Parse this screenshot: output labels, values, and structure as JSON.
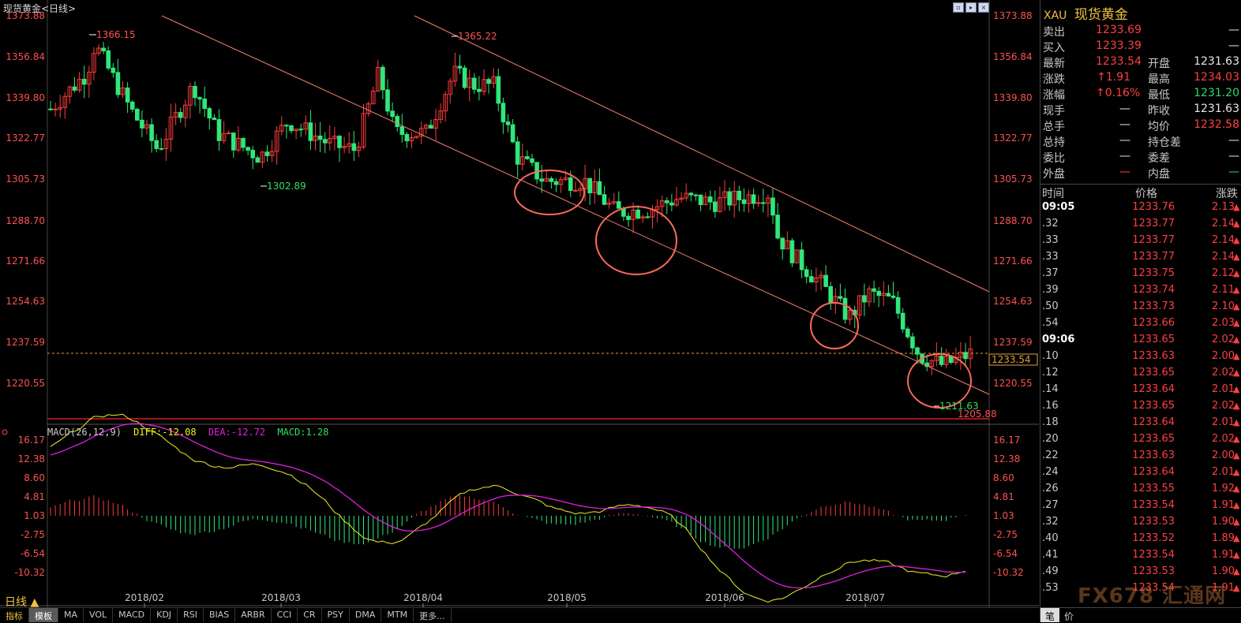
{
  "window": {
    "title": "现货黄金<日线>"
  },
  "chart": {
    "price_axis": [
      "1373.88",
      "1356.84",
      "1339.80",
      "1322.77",
      "1305.73",
      "1288.70",
      "1271.66",
      "1254.63",
      "1237.59",
      "1220.55"
    ],
    "macd_axis": [
      "16.17",
      "12.38",
      "8.60",
      "4.81",
      "1.03",
      "-2.75",
      "-6.54",
      "-10.32"
    ],
    "x_labels": [
      "2018/02",
      "2018/03",
      "2018/04",
      "2018/05",
      "2018/06",
      "2018/07"
    ],
    "annotations": {
      "high1": "1366.15",
      "high2": "1365.22",
      "low1": "1302.89",
      "low2": "1211.63",
      "bottom_price": "1205.88",
      "current_price": "1233.54"
    },
    "macd_legend": {
      "name": "MACD(26,12,9)",
      "diff": "DIFF:-12.08",
      "dea": "DEA:-12.72",
      "macd": "MACD:1.28"
    },
    "period_label": "日线 ▲",
    "colors": {
      "up": "#ff3b3b",
      "down": "#2ee87a",
      "diff": "#f0f020",
      "dea": "#e020e0",
      "trend": "#f08070"
    }
  },
  "indicator_tabs": [
    "指标",
    "模板",
    "MA",
    "VOL",
    "MACD",
    "KDJ",
    "RSI",
    "BIAS",
    "ARBR",
    "CCI",
    "CR",
    "PSY",
    "DMA",
    "MTM",
    "更多..."
  ],
  "quote": {
    "code": "XAU",
    "name": "现货黄金",
    "rows": [
      {
        "l1": "卖出",
        "v1": "1233.69",
        "c1": "red",
        "l2": "",
        "v2": "—",
        "c2": "white"
      },
      {
        "l1": "买入",
        "v1": "1233.39",
        "c1": "red",
        "l2": "",
        "v2": "—",
        "c2": "white"
      },
      {
        "l1": "最新",
        "v1": "1233.54",
        "c1": "red",
        "l2": "开盘",
        "v2": "1231.63",
        "c2": "white"
      },
      {
        "l1": "涨跌",
        "v1": "↑1.91",
        "c1": "red",
        "l2": "最高",
        "v2": "1234.03",
        "c2": "red"
      },
      {
        "l1": "涨幅",
        "v1": "↑0.16%",
        "c1": "red",
        "l2": "最低",
        "v2": "1231.20",
        "c2": "green"
      },
      {
        "l1": "现手",
        "v1": "—",
        "c1": "white",
        "l2": "昨收",
        "v2": "1231.63",
        "c2": "white"
      },
      {
        "l1": "总手",
        "v1": "—",
        "c1": "white",
        "l2": "均价",
        "v2": "1232.58",
        "c2": "red"
      },
      {
        "l1": "总持",
        "v1": "—",
        "c1": "white",
        "l2": "持仓差",
        "v2": "—",
        "c2": "white"
      },
      {
        "l1": "委比",
        "v1": "—",
        "c1": "white",
        "l2": "委差",
        "v2": "—",
        "c2": "white"
      },
      {
        "l1": "外盘",
        "v1": "—",
        "c1": "red",
        "l2": "内盘",
        "v2": "—",
        "c2": "green"
      }
    ]
  },
  "ticks": {
    "headers": {
      "time": "时间",
      "price": "价格",
      "change": "涨跌"
    },
    "rows": [
      {
        "t": "09:05",
        "p": "1233.76",
        "c": "2.13"
      },
      {
        "t": ".32",
        "p": "1233.77",
        "c": "2.14"
      },
      {
        "t": ".33",
        "p": "1233.77",
        "c": "2.14"
      },
      {
        "t": ".33",
        "p": "1233.77",
        "c": "2.14"
      },
      {
        "t": ".37",
        "p": "1233.75",
        "c": "2.12"
      },
      {
        "t": ".39",
        "p": "1233.74",
        "c": "2.11"
      },
      {
        "t": ".50",
        "p": "1233.73",
        "c": "2.10"
      },
      {
        "t": ".54",
        "p": "1233.66",
        "c": "2.03"
      },
      {
        "t": "09:06",
        "p": "1233.65",
        "c": "2.02"
      },
      {
        "t": ".10",
        "p": "1233.63",
        "c": "2.00"
      },
      {
        "t": ".12",
        "p": "1233.65",
        "c": "2.02"
      },
      {
        "t": ".14",
        "p": "1233.64",
        "c": "2.01"
      },
      {
        "t": ".16",
        "p": "1233.65",
        "c": "2.02"
      },
      {
        "t": ".18",
        "p": "1233.64",
        "c": "2.01"
      },
      {
        "t": ".20",
        "p": "1233.65",
        "c": "2.02"
      },
      {
        "t": ".22",
        "p": "1233.63",
        "c": "2.00"
      },
      {
        "t": ".24",
        "p": "1233.64",
        "c": "2.01"
      },
      {
        "t": ".26",
        "p": "1233.55",
        "c": "1.92"
      },
      {
        "t": ".27",
        "p": "1233.54",
        "c": "1.91"
      },
      {
        "t": ".32",
        "p": "1233.53",
        "c": "1.90"
      },
      {
        "t": ".40",
        "p": "1233.52",
        "c": "1.89"
      },
      {
        "t": ".41",
        "p": "1233.54",
        "c": "1.91"
      },
      {
        "t": ".49",
        "p": "1233.53",
        "c": "1.90"
      },
      {
        "t": ".53",
        "p": "1233.54",
        "c": "1.91"
      }
    ],
    "bottom_tabs": [
      "笔",
      "价"
    ]
  },
  "watermark": "FX678 汇通网"
}
